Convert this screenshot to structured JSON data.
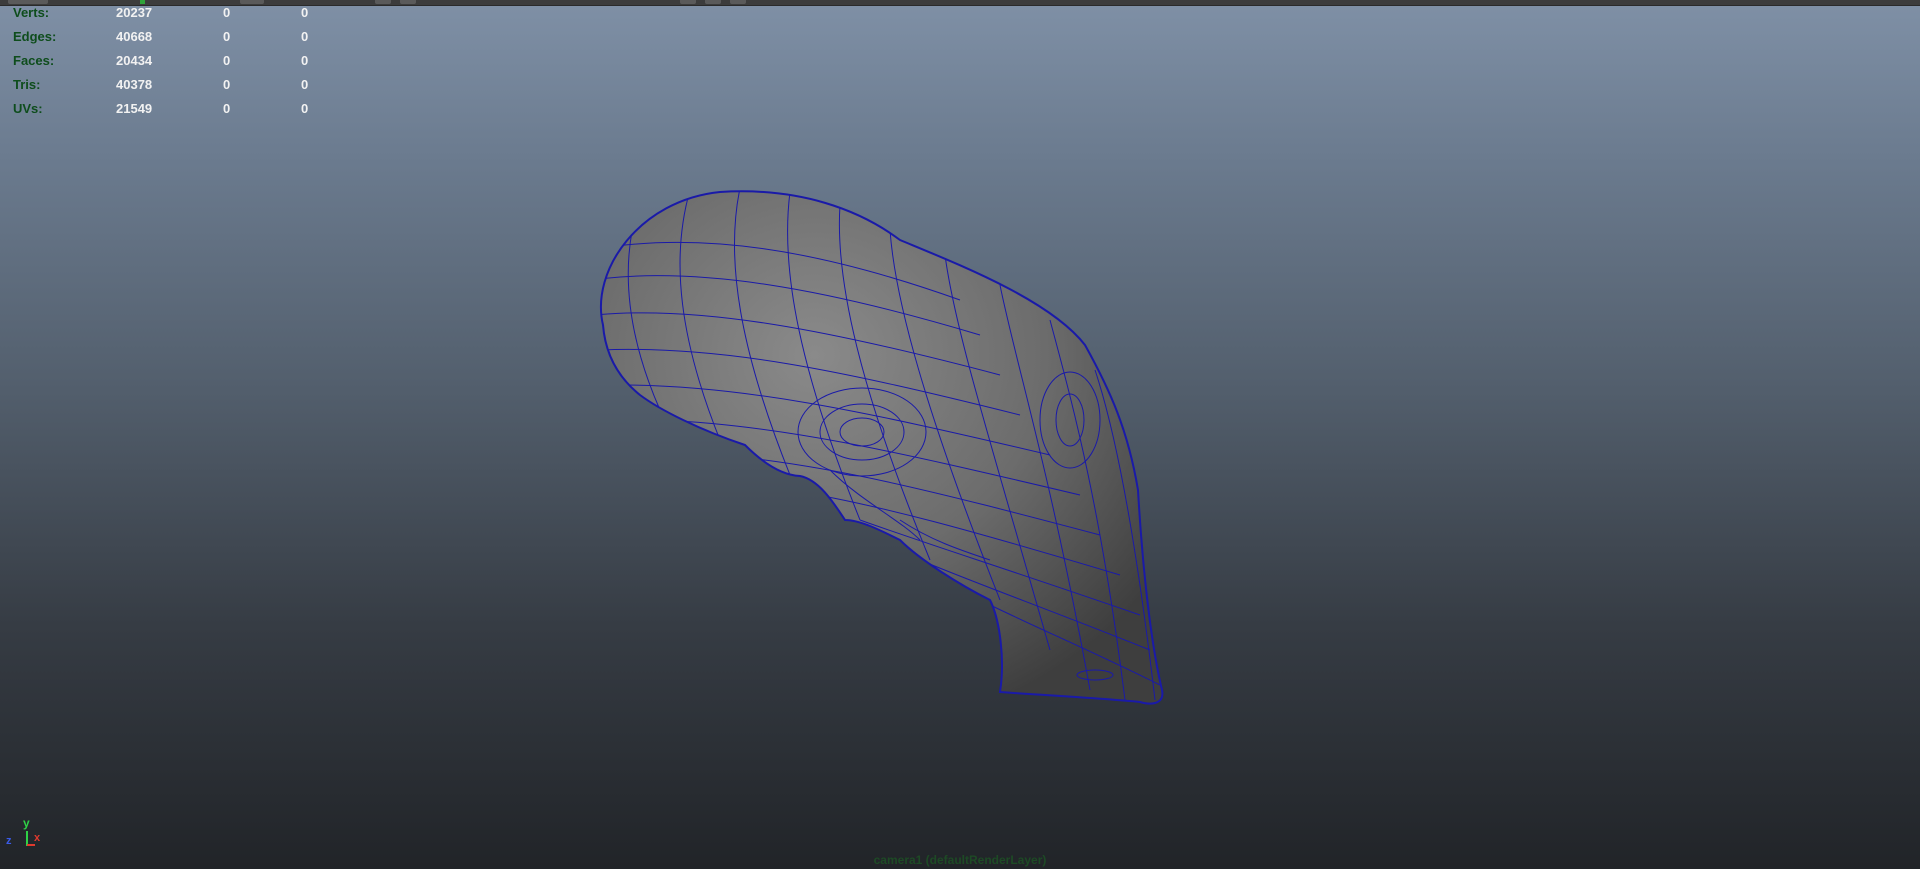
{
  "hud": {
    "rows": [
      {
        "label": "Verts:",
        "v1": "20237",
        "v2": "0",
        "v3": "0"
      },
      {
        "label": "Edges:",
        "v1": "40668",
        "v2": "0",
        "v3": "0"
      },
      {
        "label": "Faces:",
        "v1": "20434",
        "v2": "0",
        "v3": "0"
      },
      {
        "label": "Tris:",
        "v1": "40378",
        "v2": "0",
        "v3": "0"
      },
      {
        "label": "UVs:",
        "v1": "21549",
        "v2": "0",
        "v3": "0"
      }
    ]
  },
  "axis": {
    "y": "y",
    "x": "x",
    "z": "z"
  },
  "camera_label": "camera1 (defaultRenderLayer)",
  "colors": {
    "hud_label": "#0e4d1c",
    "hud_value": "#f2f2f2",
    "wireframe": "#1a1aa8",
    "mesh_fill": "#6e6e6e"
  },
  "icons": {
    "axis_gizmo": "xyz-axis-icon"
  }
}
